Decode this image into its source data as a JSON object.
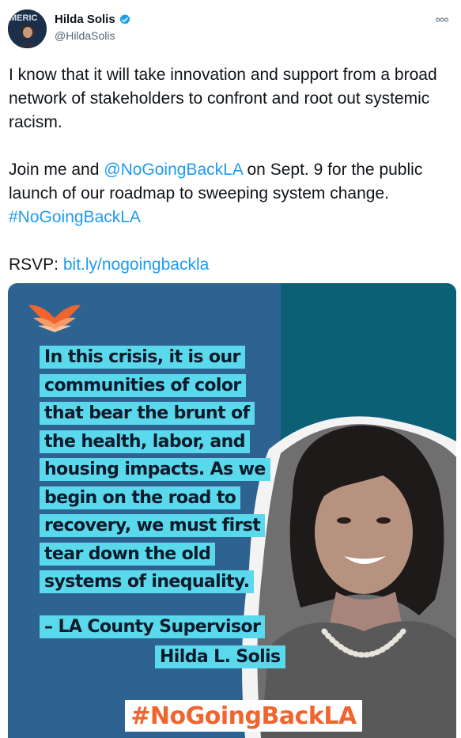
{
  "user": {
    "display_name": "Hilda Solis",
    "handle": "@HildaSolis",
    "verified": true,
    "avatar_text": "MERIC"
  },
  "tweet": {
    "line1": "I know that it will take innovation and support from a broad network of stakeholders to confront and root out systemic racism.",
    "para2_prefix": "Join me and ",
    "para2_mention": "@NoGoingBackLA",
    "para2_suffix": " on Sept. 9 for the public launch of our roadmap to sweeping system change.",
    "hashtag": "#NoGoingBackLA",
    "rsvp_label": "RSVP: ",
    "rsvp_link": "bit.ly/nogoingbackla"
  },
  "media": {
    "quote_lines": [
      "In this crisis, it is our",
      "communities of color",
      "that bear the brunt of",
      "the health, labor, and",
      "housing impacts. As we",
      "begin on the road to",
      "recovery, we must first",
      "tear down the old",
      "systems of inequality."
    ],
    "attribution_1": "– LA County Supervisor",
    "attribution_2": "Hilda L. Solis",
    "banner_hashtag": "#NoGoingBackLA"
  },
  "icons": {
    "more": "more-options-icon",
    "verified": "verified-badge-icon",
    "logo": "butterfly-logo-icon"
  },
  "colors": {
    "link": "#1d9bf0",
    "media_blue": "#2e6391",
    "media_teal": "#0c6075",
    "highlight": "#5ad8ec",
    "banner_orange": "#f0642d"
  }
}
